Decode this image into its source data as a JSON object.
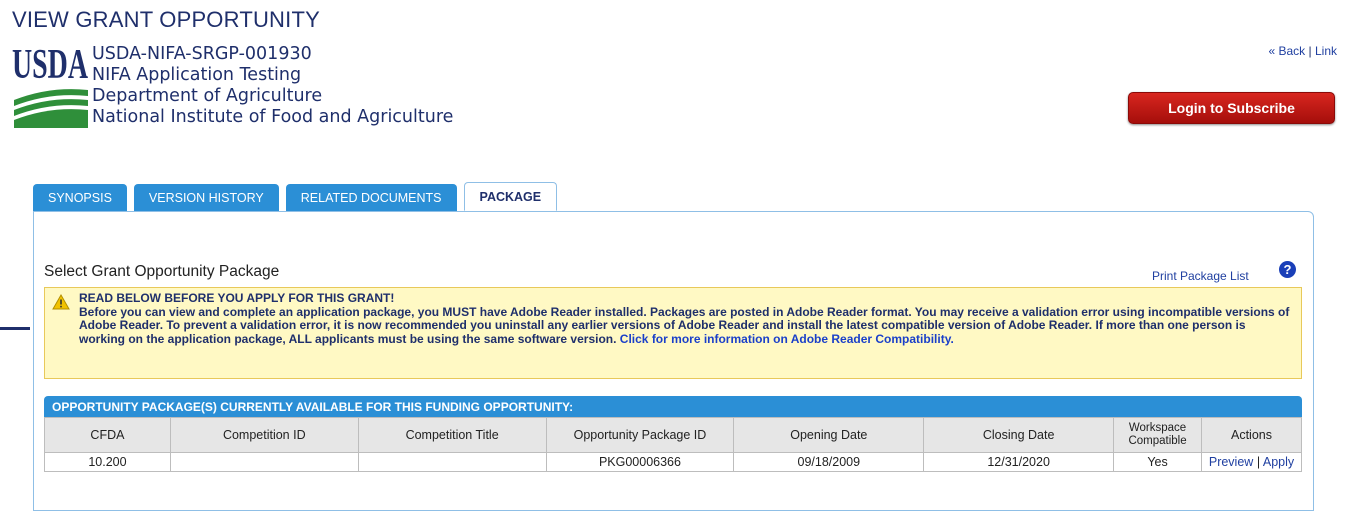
{
  "header": {
    "title": "VIEW GRANT OPPORTUNITY",
    "logo_text": "USDA",
    "opportunity_number": "USDA-NIFA-SRGP-001930",
    "opportunity_title": "NIFA Application Testing",
    "agency": "Department of Agriculture",
    "sub_agency": "National Institute of Food and Agriculture"
  },
  "toplinks": {
    "back": "« Back",
    "separator": "|",
    "link": "Link"
  },
  "login_button": "Login to Subscribe",
  "tabs": [
    {
      "label": "SYNOPSIS"
    },
    {
      "label": "VERSION HISTORY"
    },
    {
      "label": "RELATED DOCUMENTS"
    },
    {
      "label": "PACKAGE"
    }
  ],
  "package": {
    "print_link": "Print Package List",
    "help_icon": "?",
    "heading": "Select Grant Opportunity Package",
    "warning_title": "READ BELOW BEFORE YOU APPLY FOR THIS GRANT!",
    "warning_body": "Before you can view and complete an application package, you MUST have Adobe Reader installed. Packages are posted in Adobe Reader format. You may receive a validation error using incompatible versions of Adobe Reader. To prevent a validation error, it is now recommended you uninstall any earlier versions of Adobe Reader and install the latest compatible version of Adobe Reader. If more than one person is working on the application package, ALL applicants must be using the same software version.",
    "warning_link": "Click for more information on Adobe Reader Compatibility.",
    "table_title": "OPPORTUNITY PACKAGE(S) CURRENTLY AVAILABLE FOR THIS FUNDING OPPORTUNITY:",
    "columns": [
      "CFDA",
      "Competition ID",
      "Competition Title",
      "Opportunity Package ID",
      "Opening Date",
      "Closing Date",
      "Workspace Compatible",
      "Actions"
    ],
    "rows": [
      {
        "cfda": "10.200",
        "competition_id": "",
        "competition_title": "",
        "package_id": "PKG00006366",
        "opening_date": "09/18/2009",
        "closing_date": "12/31/2020",
        "workspace": "Yes",
        "preview": "Preview",
        "sep": "|",
        "apply": "Apply"
      }
    ]
  },
  "colors": {
    "tab_blue": "#2b8fd6",
    "navy": "#1f2f6b",
    "login_red": "#c41a16",
    "warning_bg": "#fff9c4"
  }
}
